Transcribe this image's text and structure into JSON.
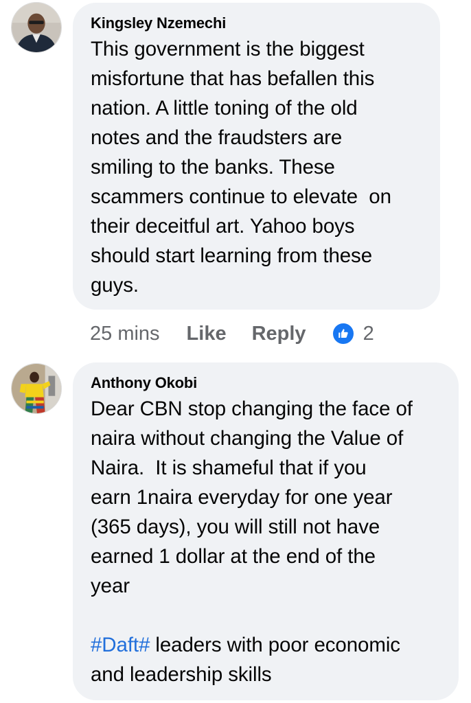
{
  "comments": [
    {
      "author": "Kingsley Nzemechi",
      "lines": [
        "This government is the biggest",
        "misfortune that has befallen this",
        "nation. A little toning of the old",
        "notes and the fraudsters are",
        "smiling to the banks. These",
        "scammers continue to elevate  on",
        "their deceitful art. Yahoo boys",
        "should start learning from these",
        "guys."
      ],
      "time": "25 mins",
      "like_label": "Like",
      "reply_label": "Reply",
      "reaction_icon": "like-reaction-icon",
      "reaction_count": "2"
    },
    {
      "author": "Anthony Okobi",
      "lines": [
        "Dear CBN stop changing the face of",
        "naira without changing the Value of",
        "Naira.  It is shameful that if you",
        "earn 1naira everyday for one year",
        "(365 days), you will still not have",
        "earned 1 dollar at the end of the",
        "year"
      ],
      "hashtag": "#Daft#",
      "hashtag_line_rest": " leaders with poor economic",
      "final_line": "and leadership skills"
    }
  ],
  "colors": {
    "bubble": "#f0f2f5",
    "link": "#216fdb",
    "meta_text": "#65676b",
    "like_blue": "#1877f2"
  }
}
